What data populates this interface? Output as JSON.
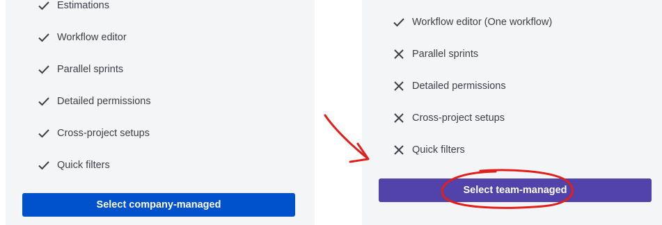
{
  "left_panel": {
    "items": [
      {
        "label": "Estimations",
        "status": "included"
      },
      {
        "label": "Workflow editor",
        "status": "included"
      },
      {
        "label": "Parallel sprints",
        "status": "included"
      },
      {
        "label": "Detailed permissions",
        "status": "included"
      },
      {
        "label": "Cross-project setups",
        "status": "included"
      },
      {
        "label": "Quick filters",
        "status": "included"
      }
    ],
    "button_label": "Select company-managed",
    "button_color": "#0052cc"
  },
  "right_panel": {
    "items": [
      {
        "label": "Workflow editor (One workflow)",
        "status": "included"
      },
      {
        "label": "Parallel sprints",
        "status": "excluded"
      },
      {
        "label": "Detailed permissions",
        "status": "excluded"
      },
      {
        "label": "Cross-project setups",
        "status": "excluded"
      },
      {
        "label": "Quick filters",
        "status": "excluded"
      }
    ],
    "button_label": "Select team-managed",
    "button_color": "#5243aa"
  },
  "icons": {
    "included": "check-icon",
    "excluded": "cross-icon"
  },
  "annotation_color": "#e0201c"
}
